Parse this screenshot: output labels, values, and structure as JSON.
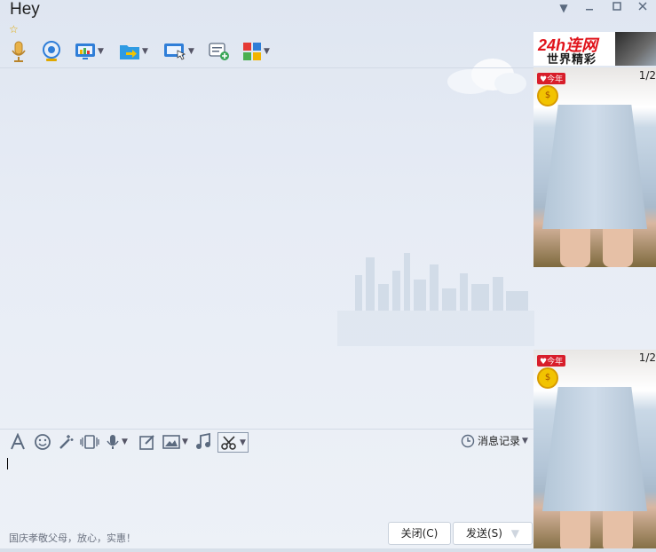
{
  "window": {
    "title": "Hey",
    "controls": [
      "minimize",
      "maximize",
      "close"
    ]
  },
  "toolbar": {
    "icons": [
      "microphone-icon",
      "webcam-icon",
      "screen-share-icon",
      "file-transfer-icon",
      "remote-desktop-icon",
      "new-chat-icon",
      "apps-icon"
    ]
  },
  "ad": {
    "line1": "24h连网",
    "line2": "世界精彩"
  },
  "product_panels": [
    {
      "tag": "♥今年",
      "counter": "1/2"
    },
    {
      "tag": "♥今年",
      "counter": "1/2"
    }
  ],
  "input_toolbar": {
    "icons": [
      "font-icon",
      "emoji-icon",
      "magic-wand-icon",
      "shake-icon",
      "voice-message-icon",
      "edit-image-icon",
      "image-icon",
      "music-icon",
      "screenshot-scissors-icon"
    ],
    "history_label": "消息记录"
  },
  "composer": {
    "hint": "国庆孝敬父母，放心，实惠！",
    "close_label": "关闭(C)",
    "send_label": "发送(S)"
  },
  "colors": {
    "accent": "#2f7ed8",
    "ad_red": "#e0141c"
  }
}
